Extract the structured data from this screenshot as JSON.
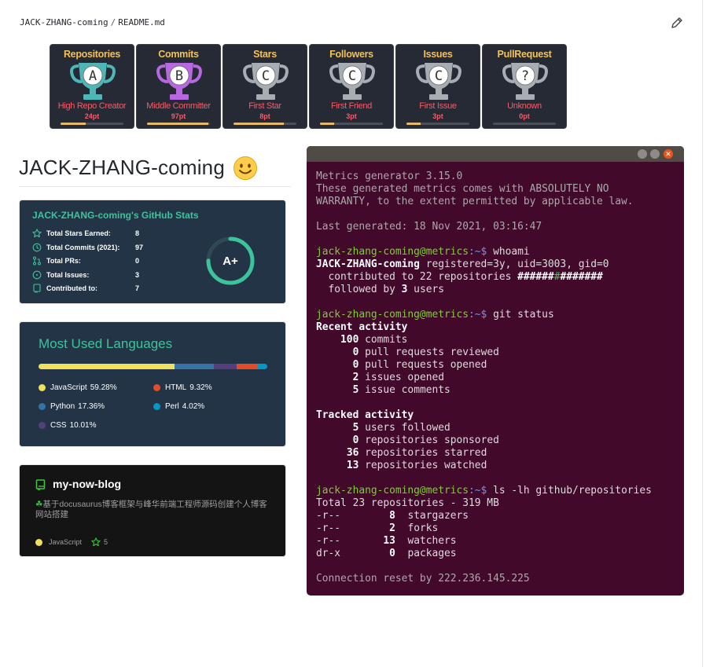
{
  "breadcrumb": {
    "owner": "JACK-ZHANG-coming",
    "separator": "/",
    "file": "README.md"
  },
  "trophies": [
    {
      "title": "Repositories",
      "rank": "A",
      "subtitle": "High Repo Creator",
      "points": "24pt",
      "progress": 0.4,
      "cup_color": "#4fb6b8"
    },
    {
      "title": "Commits",
      "rank": "B",
      "subtitle": "Middle Committer",
      "points": "97pt",
      "progress": 0.97,
      "cup_color": "#b768e0"
    },
    {
      "title": "Stars",
      "rank": "C",
      "subtitle": "First Star",
      "points": "8pt",
      "progress": 0.8,
      "cup_color": "#a8adb3"
    },
    {
      "title": "Followers",
      "rank": "C",
      "subtitle": "First Friend",
      "points": "3pt",
      "progress": 0.22,
      "cup_color": "#a8adb3"
    },
    {
      "title": "Issues",
      "rank": "C",
      "subtitle": "First Issue",
      "points": "3pt",
      "progress": 0.22,
      "cup_color": "#a8adb3"
    },
    {
      "title": "PullRequest",
      "rank": "?",
      "subtitle": "Unknown",
      "points": "0pt",
      "progress": 0.0,
      "cup_color": "#a8adb3"
    }
  ],
  "profile": {
    "heading": "JACK-ZHANG-coming",
    "emoji": "🙂"
  },
  "stats": {
    "title": "JACK-ZHANG-coming's GitHub Stats",
    "rows": [
      {
        "label": "Total Stars Earned:",
        "value": "8",
        "icon": "star-icon"
      },
      {
        "label": "Total Commits (2021):",
        "value": "97",
        "icon": "history-icon"
      },
      {
        "label": "Total PRs:",
        "value": "0",
        "icon": "pull-request-icon"
      },
      {
        "label": "Total Issues:",
        "value": "3",
        "icon": "issue-icon"
      },
      {
        "label": "Contributed to:",
        "value": "7",
        "icon": "repo-icon"
      }
    ],
    "grade": "A+",
    "grade_progress": 0.75,
    "colors": {
      "title": "#3dc39c",
      "bg": "#243447"
    }
  },
  "languages": {
    "title": "Most Used Languages",
    "items": [
      {
        "name": "JavaScript",
        "percent": "59.28%",
        "value": 59.28,
        "color": "#f1e05a"
      },
      {
        "name": "Python",
        "percent": "17.36%",
        "value": 17.36,
        "color": "#3572a5"
      },
      {
        "name": "CSS",
        "percent": "10.01%",
        "value": 10.01,
        "color": "#563d7c"
      },
      {
        "name": "HTML",
        "percent": "9.32%",
        "value": 9.32,
        "color": "#e34c26"
      },
      {
        "name": "Perl",
        "percent": "4.02%",
        "value": 4.02,
        "color": "#0298c3"
      }
    ]
  },
  "repo": {
    "name": "my-now-blog",
    "desc_prefix": "☘",
    "description": "基于docusaurus博客框架与峰华前端工程师源码创建个人博客网站搭建",
    "language": "JavaScript",
    "stars": "5"
  },
  "terminal": {
    "buttons": [
      "minimize",
      "maximize",
      "close"
    ],
    "version_line": "Metrics generator 3.15.0",
    "license_1": "These generated metrics comes with ABSOLUTELY NO",
    "license_2": "WARRANTY, to the extent permitted by applicable law.",
    "generated": "Last generated: 18 Nov 2021, 03:16:47",
    "prompt_user": "jack-zhang-coming@metrics",
    "prompt_path": ":~$",
    "cmd_whoami": "whoami",
    "whoami_user": "JACK-ZHANG-coming",
    "whoami_rest": " registered=3y, uid=3003, gid=0",
    "contrib_prefix": "  contributed to 22 repositories ",
    "contrib_hash_1": "######",
    "contrib_hash_2": "#",
    "contrib_hash_3": "#######",
    "followed_prefix": "  followed by ",
    "followed_count": "3",
    "followed_suffix": " users",
    "cmd_status": "git status",
    "recent_title": "Recent activity",
    "recent": [
      {
        "count": "100",
        "label": "commits"
      },
      {
        "count": "0",
        "label": "pull requests reviewed"
      },
      {
        "count": "0",
        "label": "pull requests opened"
      },
      {
        "count": "2",
        "label": "issues opened"
      },
      {
        "count": "5",
        "label": "issue comments"
      }
    ],
    "tracked_title": "Tracked activity",
    "tracked": [
      {
        "count": "5",
        "label": "users followed"
      },
      {
        "count": "0",
        "label": "repositories sponsored"
      },
      {
        "count": "36",
        "label": "repositories starred"
      },
      {
        "count": "13",
        "label": "repositories watched"
      }
    ],
    "cmd_ls": "ls -lh github/repositories",
    "total_line": "Total 23 repositories - 319 MB",
    "ls_rows": [
      {
        "perm": "-r--",
        "count": "8",
        "label": "stargazers"
      },
      {
        "perm": "-r--",
        "count": "2",
        "label": "forks"
      },
      {
        "perm": "-r--",
        "count": "13",
        "label": "watchers"
      },
      {
        "perm": "dr-x",
        "count": "0",
        "label": "packages"
      }
    ],
    "reset_line": "Connection reset by 222.236.145.225"
  }
}
